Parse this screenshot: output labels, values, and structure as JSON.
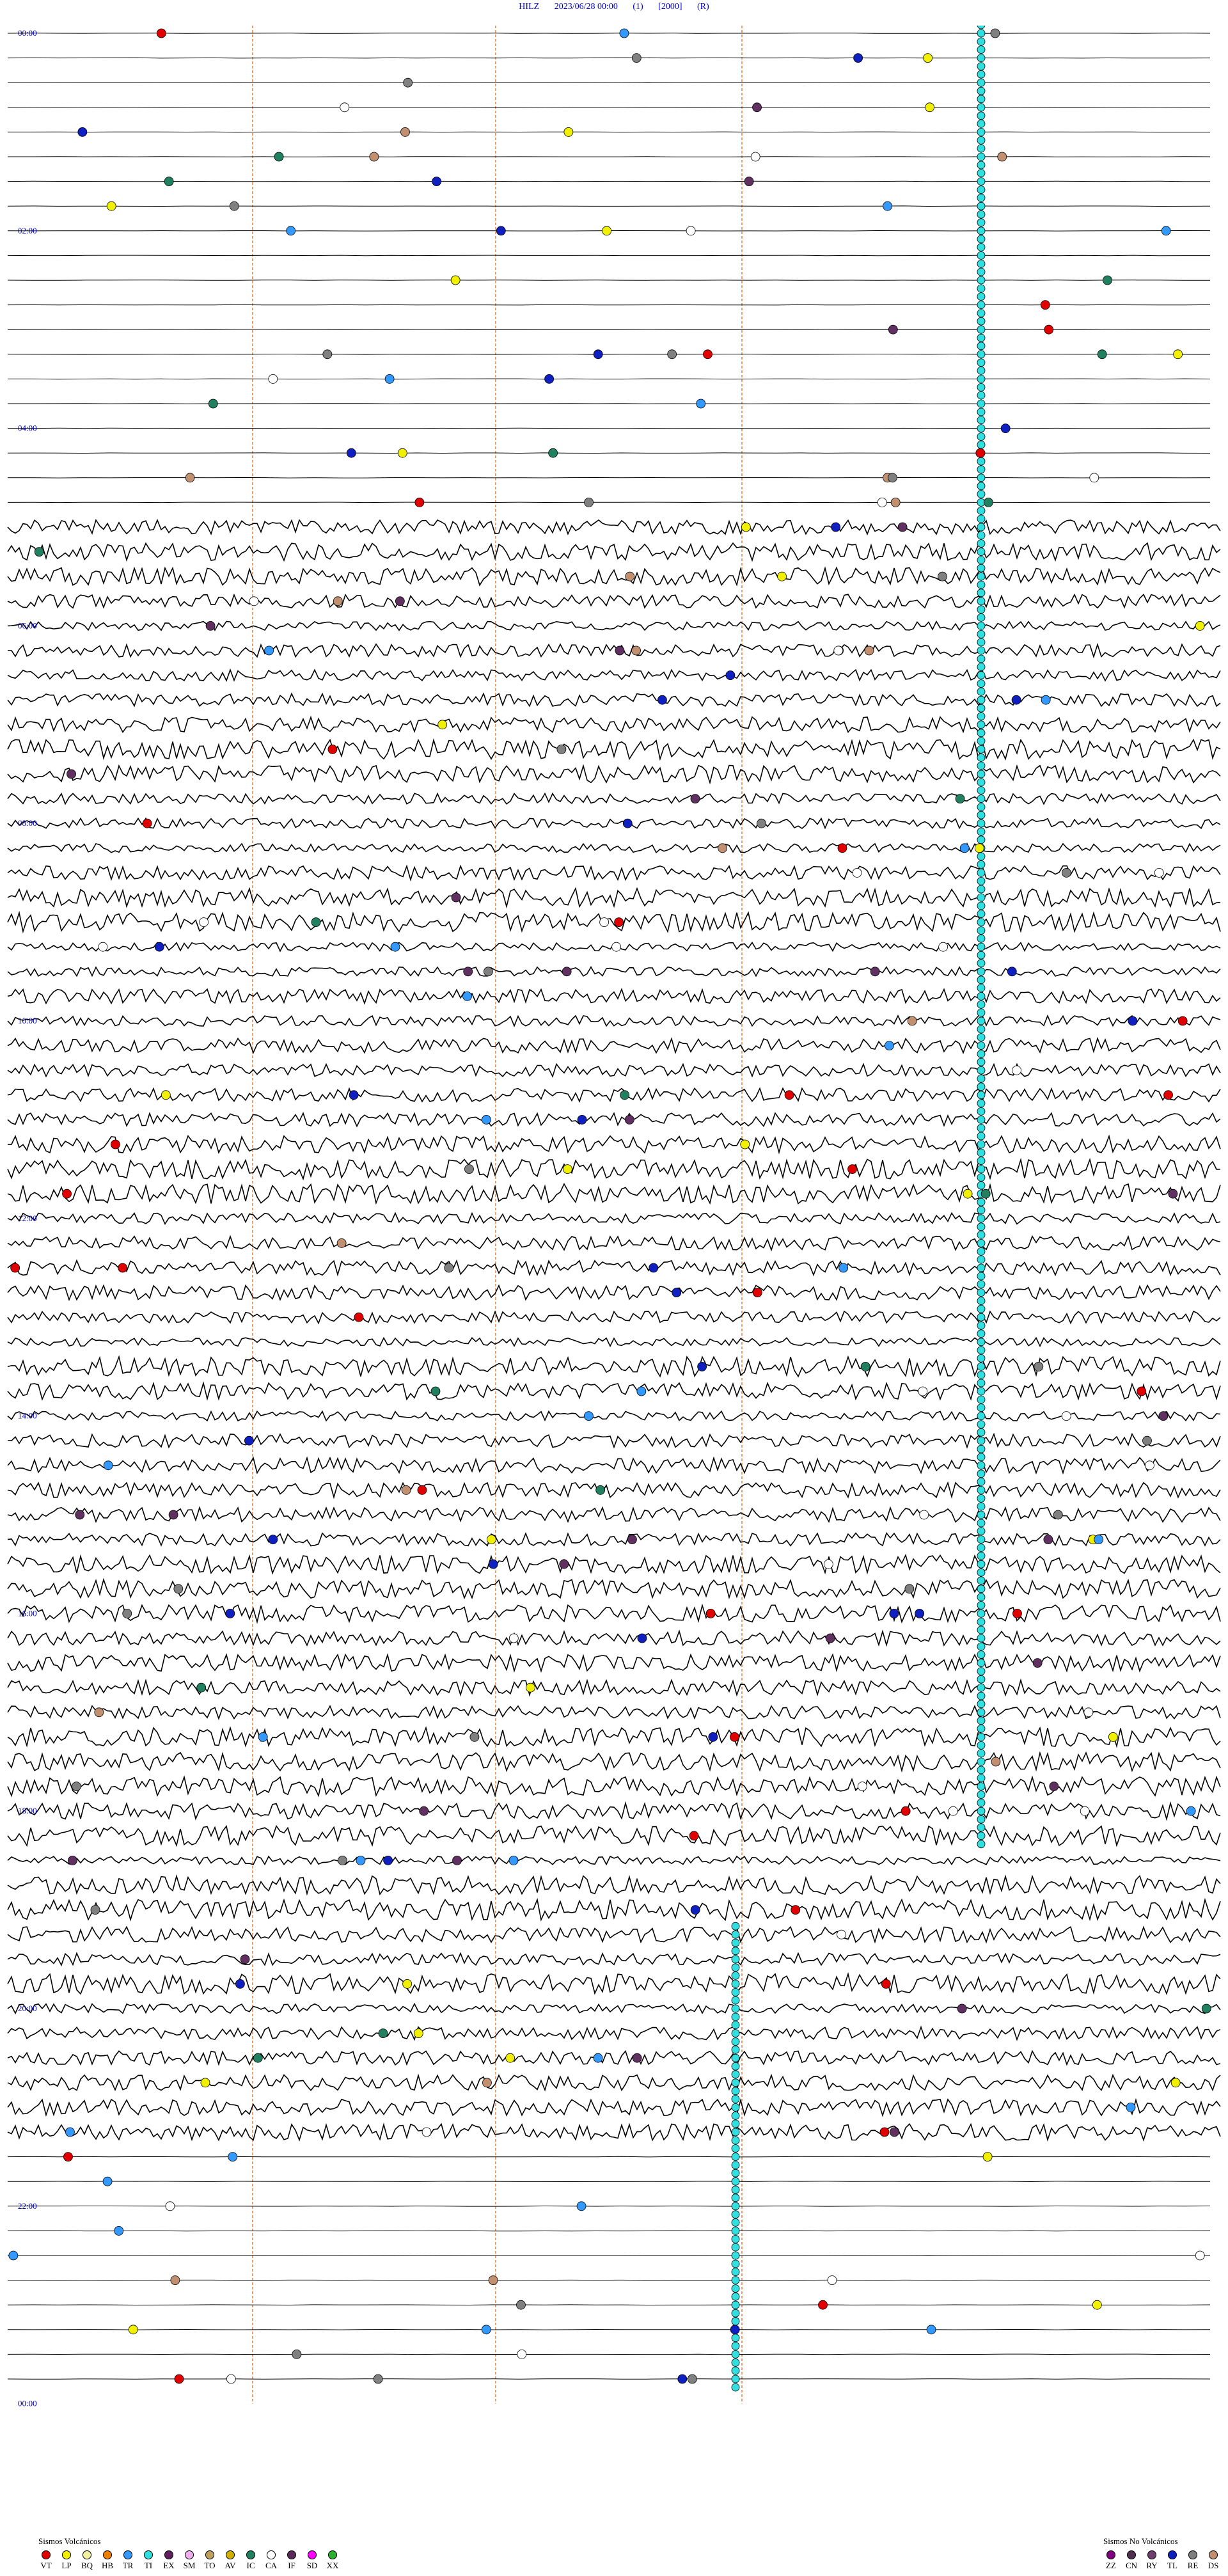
{
  "header": {
    "station": "HILZ",
    "datetime": "2023/06/28 00:00",
    "channel": "(1)",
    "gain": "[2000]",
    "mode": "(R)"
  },
  "hour_labels": [
    "00:00",
    "02:00",
    "04:00",
    "06:00",
    "08:00",
    "10:00",
    "12:00",
    "14:00",
    "16:00",
    "18:00",
    "20:00",
    "22:00",
    "00:00"
  ],
  "legend_volcanic": {
    "title": "Sismos Volcánicos",
    "items": [
      {
        "code": "VT",
        "color": "#e00000"
      },
      {
        "code": "LP",
        "color": "#f0f000"
      },
      {
        "code": "BQ",
        "color": "#f0f0a0"
      },
      {
        "code": "HB",
        "color": "#f08000"
      },
      {
        "code": "TR",
        "color": "#3399ff"
      },
      {
        "code": "TI",
        "color": "#30e0e0"
      },
      {
        "code": "EX",
        "color": "#602060"
      },
      {
        "code": "SM",
        "color": "#f0b0f0"
      },
      {
        "code": "TO",
        "color": "#c0a060"
      },
      {
        "code": "AV",
        "color": "#d0b000"
      },
      {
        "code": "IC",
        "color": "#208060"
      },
      {
        "code": "CA",
        "color": "#ffffff"
      },
      {
        "code": "IF",
        "color": "#5a2a5a"
      },
      {
        "code": "SD",
        "color": "#ff00ff"
      },
      {
        "code": "XX",
        "color": "#30b030"
      }
    ]
  },
  "legend_nonvolcanic": {
    "title": "Sismos No Volcánicos",
    "items": [
      {
        "code": "ZZ",
        "color": "#800080"
      },
      {
        "code": "CN",
        "color": "#503050"
      },
      {
        "code": "RY",
        "color": "#704070"
      },
      {
        "code": "TL",
        "color": "#1020c0"
      },
      {
        "code": "RE",
        "color": "#808080"
      },
      {
        "code": "DS",
        "color": "#c09070"
      }
    ]
  },
  "trace_color": "#000000",
  "marker_line_color": "#e08040",
  "label_color": "#0000cc"
}
